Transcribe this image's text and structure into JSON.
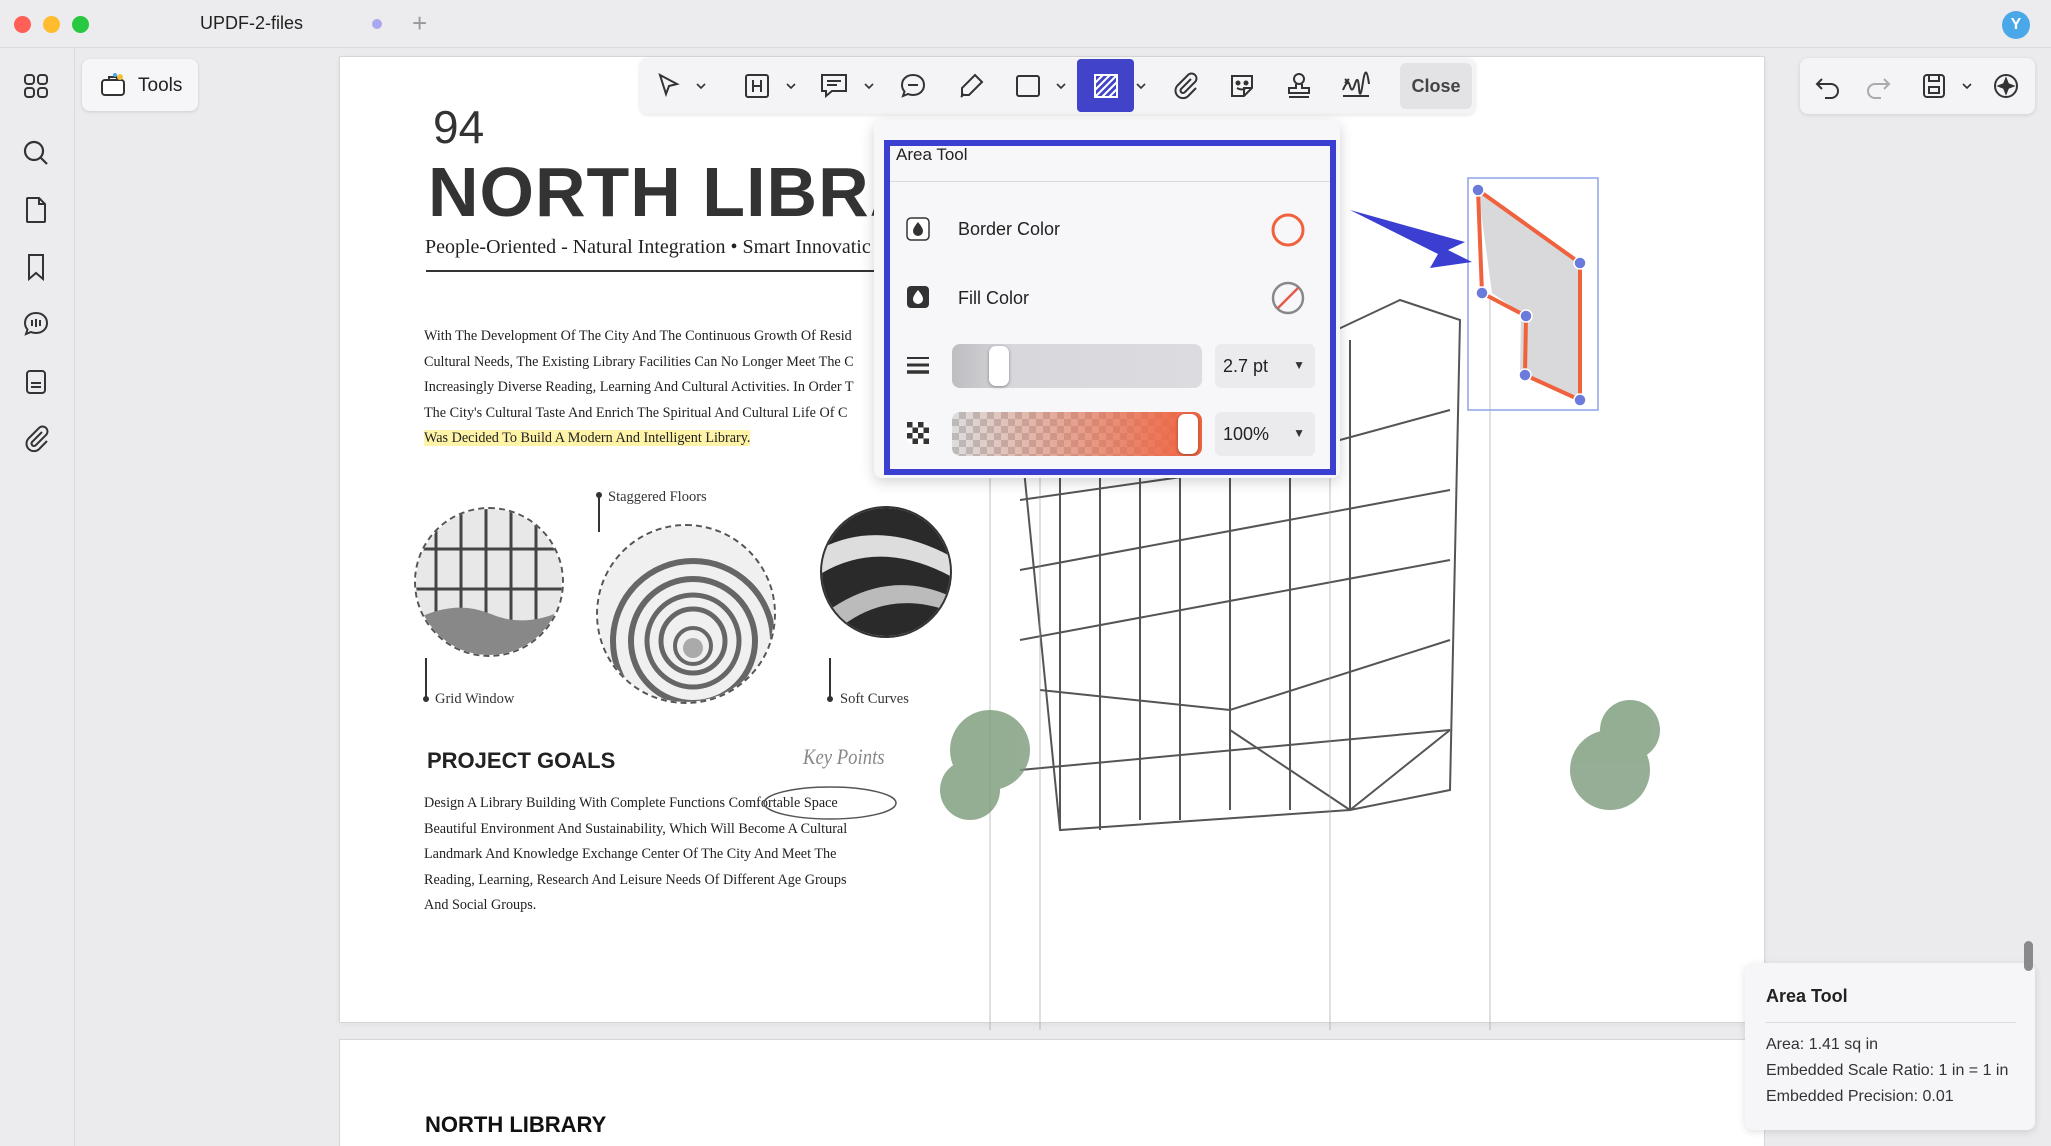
{
  "window": {
    "tab_title": "UPDF-2-files",
    "user_initial": "Y"
  },
  "tools_button": {
    "label": "Tools"
  },
  "toolbar": {
    "close_label": "Close"
  },
  "area_popup": {
    "title": "Area Tool",
    "border_color_label": "Border Color",
    "fill_color_label": "Fill Color",
    "stroke_width_value": "2.7 pt",
    "opacity_value": "100%",
    "border_color": "#f0623e",
    "fill_color": "none",
    "stroke_width_level": 0.15,
    "opacity_level": 1.0
  },
  "info_card": {
    "title": "Area Tool",
    "area": "Area: 1.41 sq in",
    "scale_ratio": "Embedded Scale Ratio: 1 in = 1 in",
    "precision": "Embedded Precision: 0.01"
  },
  "document": {
    "page_number": "94",
    "title": "NORTH LIBRA",
    "subtitle": "People-Oriented - Natural Integration • Smart Innovatic",
    "intro_lines": [
      "With The Development Of The City And The Continuous Growth Of Resid",
      "Cultural Needs, The Existing Library Facilities Can No Longer Meet The C",
      "Increasingly Diverse Reading, Learning And Cultural Activities. In Order T",
      "The City's Cultural Taste And Enrich The Spiritual And Cultural Life Of C",
      "Was Decided To Build A Modern And Intelligent Library."
    ],
    "captions": {
      "staggered": "Staggered Floors",
      "grid": "Grid Window",
      "soft": "Soft Curves"
    },
    "goals_title": "PROJECT GOALS",
    "key_points": "Key Points",
    "goals_lines": [
      "Design A Library Building With Complete Functions Comfortable Space",
      "Beautiful Environment And Sustainability, Which Will Become A Cultural",
      "Landmark And Knowledge Exchange Center Of The City And Meet The",
      "Reading, Learning, Research And Leisure Needs Of Different Age Groups",
      "And Social Groups."
    ],
    "page2_title": "NORTH LIBRARY"
  },
  "colors": {
    "accent": "#3b3fd1",
    "annotation": "#f0623e",
    "highlight": "#fff3a8"
  },
  "icons": {
    "rail": [
      "grid-icon",
      "search-icon",
      "page-icon",
      "bookmark-icon",
      "comment-icon",
      "form-icon",
      "attachment-icon"
    ],
    "toolbar": [
      "select-arrow-icon",
      "highlight-text-icon",
      "sticky-note-icon",
      "comment-bubble-icon",
      "pencil-icon",
      "rectangle-shape-icon",
      "area-tool-icon",
      "attachment-icon",
      "sticker-icon",
      "stamp-icon",
      "signature-icon"
    ]
  }
}
